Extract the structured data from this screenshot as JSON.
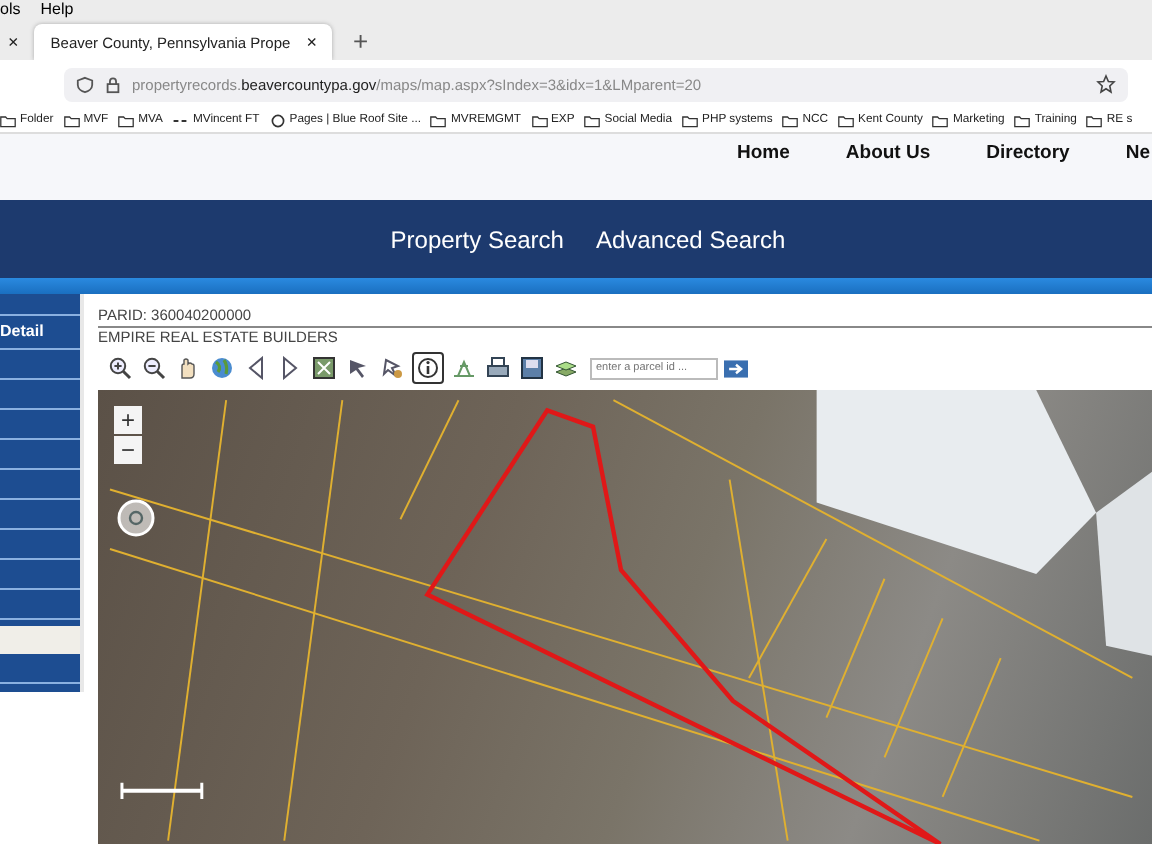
{
  "menu_bar": {
    "items": [
      "ols",
      "Help"
    ]
  },
  "tabs": [
    {
      "selected": false,
      "close": "×"
    },
    {
      "label": "Beaver County, Pennsylvania Prope",
      "selected": true,
      "close": "×"
    }
  ],
  "new_tab": "+",
  "address_bar": {
    "prefix": "propertyrecords.",
    "domain": "beavercountypa.gov",
    "path": "/maps/map.aspx?sIndex=3&idx=1&LMparent=20"
  },
  "bookmarks": [
    {
      "kind": "folder",
      "label": "Folder"
    },
    {
      "kind": "folder",
      "label": "MVF"
    },
    {
      "kind": "folder",
      "label": "MVA"
    },
    {
      "kind": "link",
      "label": "MVincent FT"
    },
    {
      "kind": "site",
      "label": "Pages | Blue Roof Site ..."
    },
    {
      "kind": "folder",
      "label": "MVREMGMT"
    },
    {
      "kind": "folder",
      "label": "EXP"
    },
    {
      "kind": "folder",
      "label": "Social Media"
    },
    {
      "kind": "folder",
      "label": "PHP systems"
    },
    {
      "kind": "folder",
      "label": "NCC"
    },
    {
      "kind": "folder",
      "label": "Kent County"
    },
    {
      "kind": "folder",
      "label": "Marketing"
    },
    {
      "kind": "folder",
      "label": "Training"
    },
    {
      "kind": "folder",
      "label": "RE s"
    }
  ],
  "site_nav": [
    "Home",
    "About Us",
    "Directory",
    "Ne"
  ],
  "search_nav": [
    "Property Search",
    "Advanced Search"
  ],
  "sidebar": {
    "items": [
      "Detail"
    ]
  },
  "parcel": {
    "parid": "PARID: 360040200000",
    "owner": "EMPIRE REAL ESTATE BUILDERS"
  },
  "map_toolbar": {
    "tools": [
      {
        "kind": "zoom-in",
        "selected": false
      },
      {
        "kind": "zoom-out",
        "selected": false
      },
      {
        "kind": "hand",
        "selected": false
      },
      {
        "kind": "globe",
        "selected": false
      },
      {
        "kind": "back",
        "selected": false
      },
      {
        "kind": "forward",
        "selected": false
      },
      {
        "kind": "select",
        "selected": false
      },
      {
        "kind": "pointer",
        "selected": false
      },
      {
        "kind": "pointer-star",
        "selected": false
      },
      {
        "kind": "info",
        "selected": true
      },
      {
        "kind": "scale",
        "selected": false
      },
      {
        "kind": "print",
        "selected": false
      },
      {
        "kind": "save",
        "selected": false
      },
      {
        "kind": "layers",
        "selected": false
      }
    ],
    "parcel_field": {
      "placeholder": "enter a parcel id ..."
    }
  },
  "map": {
    "zoom_in": "+",
    "zoom_out": "−"
  }
}
